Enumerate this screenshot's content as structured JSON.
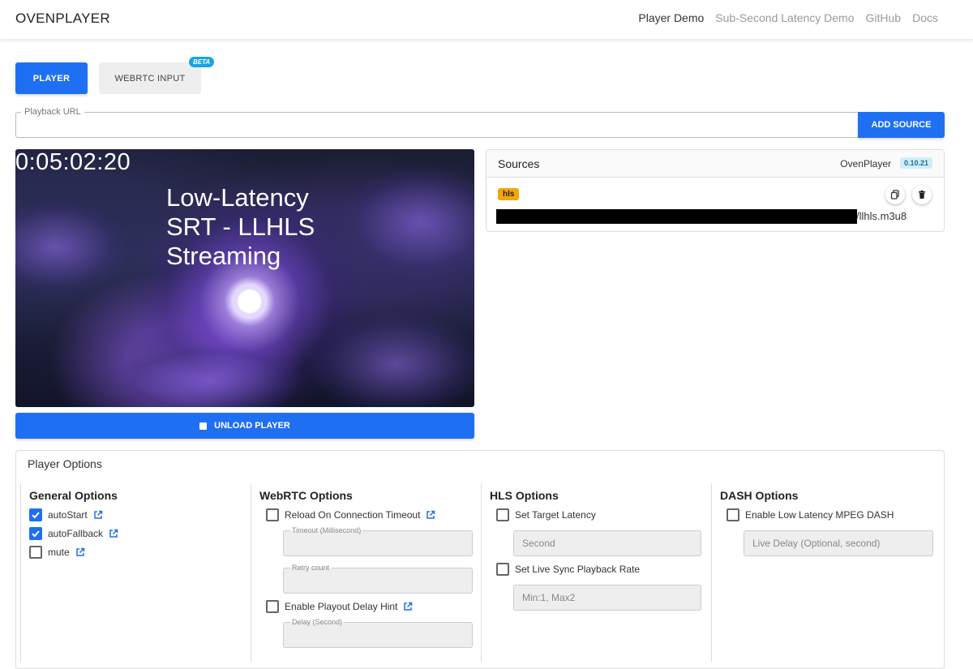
{
  "nav": {
    "brand": "OVENPLAYER",
    "links": [
      "Player Demo",
      "Sub-Second Latency Demo",
      "GitHub",
      "Docs"
    ]
  },
  "tabs": {
    "player": "PLAYER",
    "webrtc_input": "WEBRTC INPUT",
    "beta_badge": "BETA"
  },
  "playback": {
    "label": "Playback URL",
    "value": "",
    "add_source": "ADD SOURCE"
  },
  "player": {
    "timer": "0:05:02:20",
    "overlay_lines": [
      "Low-Latency",
      "SRT - LLHLS",
      "Streaming"
    ],
    "unload_label": "UNLOAD PLAYER"
  },
  "sources": {
    "title": "Sources",
    "player_name": "OvenPlayer",
    "version": "0.10.21",
    "items": [
      {
        "type": "hls",
        "url_tail": "/llhls.m3u8"
      }
    ]
  },
  "options": {
    "title": "Player Options",
    "general": {
      "title": "General Options",
      "items": [
        {
          "label": "autoStart",
          "checked": true
        },
        {
          "label": "autoFallback",
          "checked": true
        },
        {
          "label": "mute",
          "checked": false
        }
      ]
    },
    "webrtc": {
      "title": "WebRTC Options",
      "reload_label": "Reload On Connection Timeout",
      "timeout_label": "Timeout (Millisecond)",
      "retry_label": "Retry count",
      "playout_label": "Enable Playout Delay Hint",
      "delay_label": "Delay (Second)"
    },
    "hls": {
      "title": "HLS Options",
      "target_latency_label": "Set Target Latency",
      "target_latency_placeholder": "Second",
      "live_sync_label": "Set Live Sync Playback Rate",
      "live_sync_placeholder": "Min:1, Max2"
    },
    "dash": {
      "title": "DASH Options",
      "low_latency_label": "Enable Low Latency MPEG DASH",
      "live_delay_placeholder": "Live Delay (Optional, second)"
    }
  },
  "colors": {
    "primary": "#1f6ff2",
    "hls_badge": "#f5a700",
    "beta_badge": "#19a3e5"
  }
}
